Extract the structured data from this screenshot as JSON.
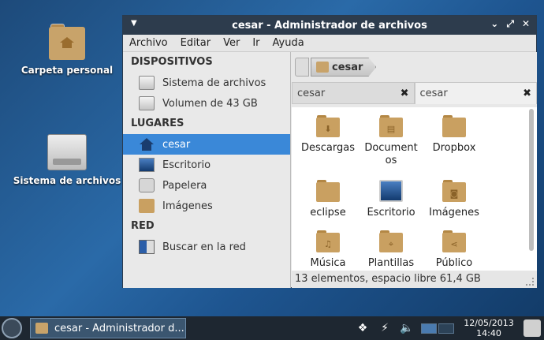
{
  "desktop": {
    "icons": [
      {
        "label": "Carpeta personal",
        "icon": "home-folder-icon"
      },
      {
        "label": "Sistema de archivos",
        "icon": "drive-icon"
      }
    ]
  },
  "window": {
    "title": "cesar - Administrador de archivos",
    "controls": [
      "minimize",
      "maximize",
      "close"
    ],
    "menu": [
      "Archivo",
      "Editar",
      "Ver",
      "Ir",
      "Ayuda"
    ],
    "sidebar": {
      "sections": [
        {
          "title": "DISPOSITIVOS",
          "items": [
            {
              "label": "Sistema de archivos",
              "icon": "drive-icon"
            },
            {
              "label": "Volumen de 43 GB",
              "icon": "drive-icon"
            }
          ]
        },
        {
          "title": "LUGARES",
          "items": [
            {
              "label": "cesar",
              "icon": "home-icon",
              "selected": true
            },
            {
              "label": "Escritorio",
              "icon": "desktop-icon"
            },
            {
              "label": "Papelera",
              "icon": "trash-icon"
            },
            {
              "label": "Imágenes",
              "icon": "pictures-folder-icon"
            }
          ]
        },
        {
          "title": "RED",
          "items": [
            {
              "label": "Buscar en la red",
              "icon": "network-icon"
            }
          ]
        }
      ]
    },
    "path": {
      "current": "cesar"
    },
    "tabs": [
      {
        "label": "cesar",
        "active": false
      },
      {
        "label": "cesar",
        "active": true
      }
    ],
    "files": [
      {
        "name": "Descargas",
        "glyph": "⬇"
      },
      {
        "name": "Documentos",
        "glyph": "▤"
      },
      {
        "name": "Dropbox",
        "glyph": ""
      },
      {
        "name": "eclipse",
        "glyph": ""
      },
      {
        "name": "Escritorio",
        "glyph": ""
      },
      {
        "name": "Imágenes",
        "glyph": "◙"
      },
      {
        "name": "Música",
        "glyph": "♫"
      },
      {
        "name": "Plantillas",
        "glyph": "⌖"
      },
      {
        "name": "Público",
        "glyph": "⋖"
      }
    ],
    "status": "13 elementos, espacio libre 61,4 GB"
  },
  "taskbar": {
    "task_label": "cesar - Administrador d...",
    "date": "12/05/2013",
    "time": "14:40"
  },
  "colors": {
    "accent": "#3a88d8",
    "titlebar": "#2d3c4d",
    "folder": "#c9a061"
  }
}
